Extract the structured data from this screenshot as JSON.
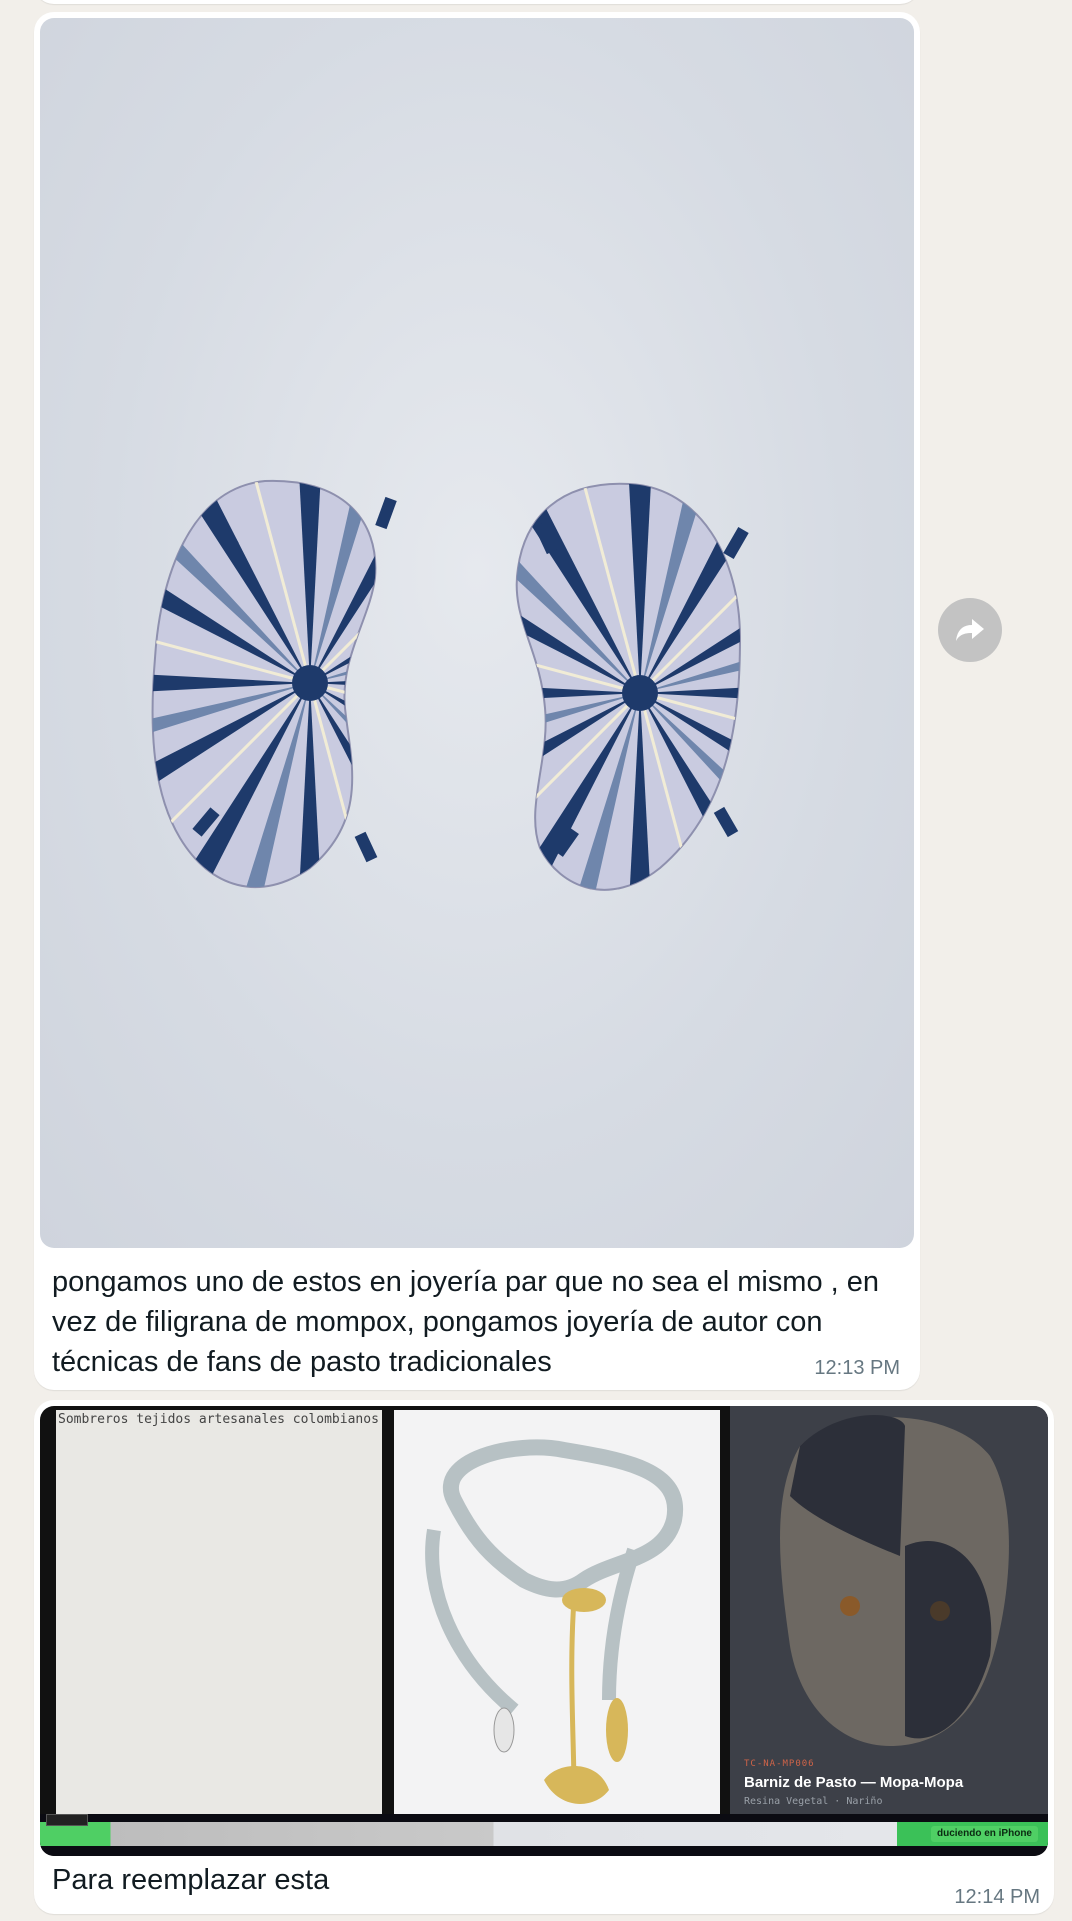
{
  "messages": [
    {
      "text": "pongamos uno de estos en joyería par que no sea el mismo , en vez de filigrana de mompox, pongamos joyería de autor con técnicas de fans de pasto tradicionales",
      "time": "12:13 PM"
    },
    {
      "text": "Para reemplazar esta",
      "time": "12:14 PM",
      "screenshot": {
        "broken_image_alt": "Sombreros tejidos artesanales colombianos",
        "card_tag": "TC-NA-MP006",
        "card_title": "Barniz de Pasto — Mopa-Mopa",
        "card_subtitle": "Resina Vegetal · Nariño",
        "dock_label": "duciendo en iPhone"
      }
    }
  ],
  "icons": {
    "forward": "forward-arrow-icon"
  },
  "colors": {
    "background": "#f2efea",
    "bubble": "#ffffff",
    "time": "#667781",
    "earring_blue": "#1e3a6b"
  }
}
